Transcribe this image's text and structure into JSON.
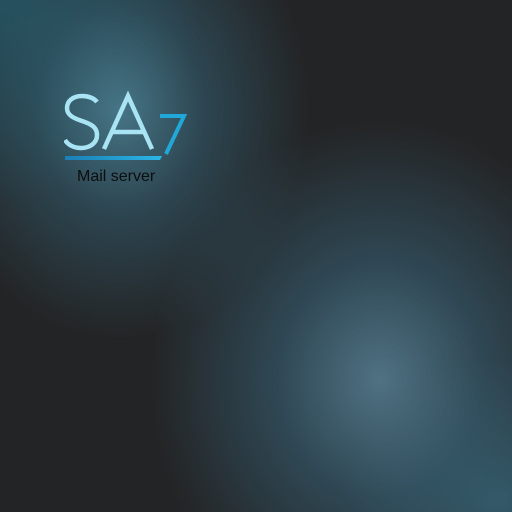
{
  "logo": {
    "brand_text": "SA7",
    "caption": "Mail server"
  },
  "colors": {
    "background_dark": "#232425",
    "teal_glow": "#4c8296",
    "logo_light_blue": "#a9e4f4",
    "logo_accent_blue": "#1fa8d8"
  }
}
